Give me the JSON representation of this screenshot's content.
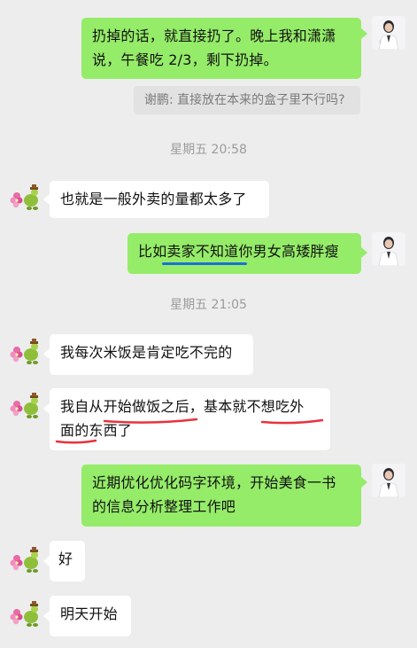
{
  "messages": {
    "m1": {
      "line1": "扔掉的话，就直接扔了。晚上我和潇潇",
      "line2": "说，午餐吃 2/3，剩下扔掉。"
    },
    "quote": "谢鹏: 直接放在本来的盒子里不行吗?",
    "time1": "星期五 20:58",
    "m2": "也就是一般外卖的量都太多了",
    "m3": "比如卖家不知道你男女高矮胖瘦",
    "time2": "星期五 21:05",
    "m4": "我每次米饭是肯定吃不完的",
    "m5": {
      "line1": "我自从开始做饭之后，基本就不想吃外",
      "line2": "面的东西了"
    },
    "m6": {
      "line1": "近期优化优化码字环境，开始美食一书",
      "line2": "的信息分析整理工作吧"
    },
    "m7": "好",
    "m8": "明天开始"
  },
  "colors": {
    "sent_bubble": "#95ec69",
    "received_bubble": "#ffffff",
    "background": "#ededed",
    "underline_blue": "#1a6fd6",
    "underline_red": "#e8323c"
  }
}
